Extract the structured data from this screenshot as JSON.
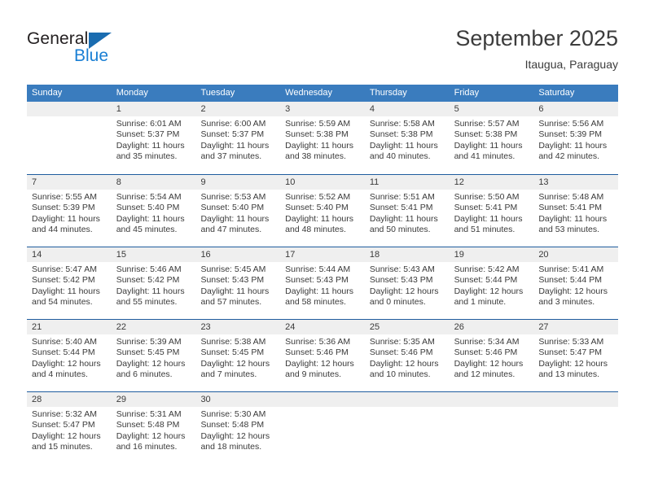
{
  "brand": {
    "name_top": "General",
    "name_bottom": "Blue",
    "triangle_icon": "triangle-icon",
    "color_top": "#231f20",
    "color_bottom": "#1a7fd4"
  },
  "header": {
    "title": "September 2025",
    "subtitle": "Itaugua, Paraguay"
  },
  "colors": {
    "header_bg": "#3a7cbe",
    "header_text": "#ffffff",
    "week_divider": "#1f5c9e",
    "day_number_bg": "#efefef",
    "cell_bg": "#ffffff",
    "text": "#3a3a3a"
  },
  "weekdays": [
    "Sunday",
    "Monday",
    "Tuesday",
    "Wednesday",
    "Thursday",
    "Friday",
    "Saturday"
  ],
  "weeks": [
    {
      "days": [
        {
          "number": "",
          "sunrise": "",
          "sunset": "",
          "daylight": ""
        },
        {
          "number": "1",
          "sunrise": "Sunrise: 6:01 AM",
          "sunset": "Sunset: 5:37 PM",
          "daylight": "Daylight: 11 hours and 35 minutes."
        },
        {
          "number": "2",
          "sunrise": "Sunrise: 6:00 AM",
          "sunset": "Sunset: 5:37 PM",
          "daylight": "Daylight: 11 hours and 37 minutes."
        },
        {
          "number": "3",
          "sunrise": "Sunrise: 5:59 AM",
          "sunset": "Sunset: 5:38 PM",
          "daylight": "Daylight: 11 hours and 38 minutes."
        },
        {
          "number": "4",
          "sunrise": "Sunrise: 5:58 AM",
          "sunset": "Sunset: 5:38 PM",
          "daylight": "Daylight: 11 hours and 40 minutes."
        },
        {
          "number": "5",
          "sunrise": "Sunrise: 5:57 AM",
          "sunset": "Sunset: 5:38 PM",
          "daylight": "Daylight: 11 hours and 41 minutes."
        },
        {
          "number": "6",
          "sunrise": "Sunrise: 5:56 AM",
          "sunset": "Sunset: 5:39 PM",
          "daylight": "Daylight: 11 hours and 42 minutes."
        }
      ]
    },
    {
      "days": [
        {
          "number": "7",
          "sunrise": "Sunrise: 5:55 AM",
          "sunset": "Sunset: 5:39 PM",
          "daylight": "Daylight: 11 hours and 44 minutes."
        },
        {
          "number": "8",
          "sunrise": "Sunrise: 5:54 AM",
          "sunset": "Sunset: 5:40 PM",
          "daylight": "Daylight: 11 hours and 45 minutes."
        },
        {
          "number": "9",
          "sunrise": "Sunrise: 5:53 AM",
          "sunset": "Sunset: 5:40 PM",
          "daylight": "Daylight: 11 hours and 47 minutes."
        },
        {
          "number": "10",
          "sunrise": "Sunrise: 5:52 AM",
          "sunset": "Sunset: 5:40 PM",
          "daylight": "Daylight: 11 hours and 48 minutes."
        },
        {
          "number": "11",
          "sunrise": "Sunrise: 5:51 AM",
          "sunset": "Sunset: 5:41 PM",
          "daylight": "Daylight: 11 hours and 50 minutes."
        },
        {
          "number": "12",
          "sunrise": "Sunrise: 5:50 AM",
          "sunset": "Sunset: 5:41 PM",
          "daylight": "Daylight: 11 hours and 51 minutes."
        },
        {
          "number": "13",
          "sunrise": "Sunrise: 5:48 AM",
          "sunset": "Sunset: 5:41 PM",
          "daylight": "Daylight: 11 hours and 53 minutes."
        }
      ]
    },
    {
      "days": [
        {
          "number": "14",
          "sunrise": "Sunrise: 5:47 AM",
          "sunset": "Sunset: 5:42 PM",
          "daylight": "Daylight: 11 hours and 54 minutes."
        },
        {
          "number": "15",
          "sunrise": "Sunrise: 5:46 AM",
          "sunset": "Sunset: 5:42 PM",
          "daylight": "Daylight: 11 hours and 55 minutes."
        },
        {
          "number": "16",
          "sunrise": "Sunrise: 5:45 AM",
          "sunset": "Sunset: 5:43 PM",
          "daylight": "Daylight: 11 hours and 57 minutes."
        },
        {
          "number": "17",
          "sunrise": "Sunrise: 5:44 AM",
          "sunset": "Sunset: 5:43 PM",
          "daylight": "Daylight: 11 hours and 58 minutes."
        },
        {
          "number": "18",
          "sunrise": "Sunrise: 5:43 AM",
          "sunset": "Sunset: 5:43 PM",
          "daylight": "Daylight: 12 hours and 0 minutes."
        },
        {
          "number": "19",
          "sunrise": "Sunrise: 5:42 AM",
          "sunset": "Sunset: 5:44 PM",
          "daylight": "Daylight: 12 hours and 1 minute."
        },
        {
          "number": "20",
          "sunrise": "Sunrise: 5:41 AM",
          "sunset": "Sunset: 5:44 PM",
          "daylight": "Daylight: 12 hours and 3 minutes."
        }
      ]
    },
    {
      "days": [
        {
          "number": "21",
          "sunrise": "Sunrise: 5:40 AM",
          "sunset": "Sunset: 5:44 PM",
          "daylight": "Daylight: 12 hours and 4 minutes."
        },
        {
          "number": "22",
          "sunrise": "Sunrise: 5:39 AM",
          "sunset": "Sunset: 5:45 PM",
          "daylight": "Daylight: 12 hours and 6 minutes."
        },
        {
          "number": "23",
          "sunrise": "Sunrise: 5:38 AM",
          "sunset": "Sunset: 5:45 PM",
          "daylight": "Daylight: 12 hours and 7 minutes."
        },
        {
          "number": "24",
          "sunrise": "Sunrise: 5:36 AM",
          "sunset": "Sunset: 5:46 PM",
          "daylight": "Daylight: 12 hours and 9 minutes."
        },
        {
          "number": "25",
          "sunrise": "Sunrise: 5:35 AM",
          "sunset": "Sunset: 5:46 PM",
          "daylight": "Daylight: 12 hours and 10 minutes."
        },
        {
          "number": "26",
          "sunrise": "Sunrise: 5:34 AM",
          "sunset": "Sunset: 5:46 PM",
          "daylight": "Daylight: 12 hours and 12 minutes."
        },
        {
          "number": "27",
          "sunrise": "Sunrise: 5:33 AM",
          "sunset": "Sunset: 5:47 PM",
          "daylight": "Daylight: 12 hours and 13 minutes."
        }
      ]
    },
    {
      "days": [
        {
          "number": "28",
          "sunrise": "Sunrise: 5:32 AM",
          "sunset": "Sunset: 5:47 PM",
          "daylight": "Daylight: 12 hours and 15 minutes."
        },
        {
          "number": "29",
          "sunrise": "Sunrise: 5:31 AM",
          "sunset": "Sunset: 5:48 PM",
          "daylight": "Daylight: 12 hours and 16 minutes."
        },
        {
          "number": "30",
          "sunrise": "Sunrise: 5:30 AM",
          "sunset": "Sunset: 5:48 PM",
          "daylight": "Daylight: 12 hours and 18 minutes."
        },
        {
          "number": "",
          "sunrise": "",
          "sunset": "",
          "daylight": ""
        },
        {
          "number": "",
          "sunrise": "",
          "sunset": "",
          "daylight": ""
        },
        {
          "number": "",
          "sunrise": "",
          "sunset": "",
          "daylight": ""
        },
        {
          "number": "",
          "sunrise": "",
          "sunset": "",
          "daylight": ""
        }
      ]
    }
  ]
}
